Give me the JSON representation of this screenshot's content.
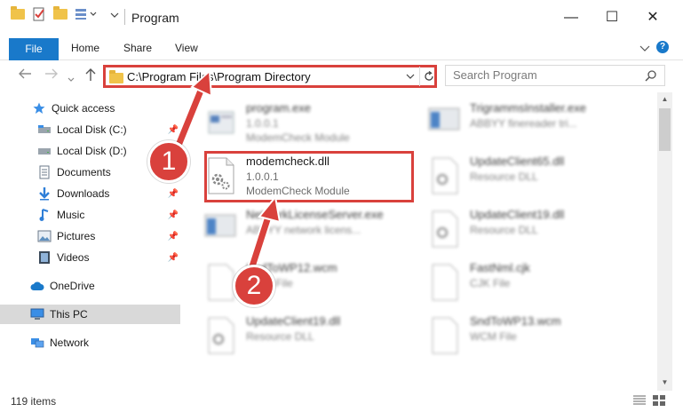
{
  "window": {
    "title": "Program",
    "minimize_glyph": "—",
    "maximize_glyph": "☐",
    "close_glyph": "✕"
  },
  "ribbon": {
    "tabs": [
      {
        "label": "File"
      },
      {
        "label": "Home"
      },
      {
        "label": "Share"
      },
      {
        "label": "View"
      }
    ]
  },
  "address": {
    "path": "C:\\Program Files\\Program Directory",
    "search_placeholder": "Search Program"
  },
  "nav_pane": {
    "items": [
      {
        "label": "Quick access",
        "icon": "star-icon"
      },
      {
        "label": "Local Disk (C:)",
        "icon": "drive-icon"
      },
      {
        "label": "Local Disk (D:)",
        "icon": "drive-icon"
      },
      {
        "label": "Documents",
        "icon": "documents-icon"
      },
      {
        "label": "Downloads",
        "icon": "download-icon"
      },
      {
        "label": "Music",
        "icon": "music-icon"
      },
      {
        "label": "Pictures",
        "icon": "pictures-icon"
      },
      {
        "label": "Videos",
        "icon": "videos-icon"
      },
      {
        "label": "OneDrive",
        "icon": "cloud-icon"
      },
      {
        "label": "This PC",
        "icon": "computer-icon"
      },
      {
        "label": "Network",
        "icon": "network-icon"
      }
    ]
  },
  "files": [
    {
      "name": "program.exe",
      "line1": "1.0.0.1",
      "line2": "ModemCheck Module"
    },
    {
      "name": "TrigrammsInstaller.exe",
      "line1": "ABBYY finereader tri...",
      "line2": ""
    },
    {
      "name": "modemcheck.dll",
      "line1": "1.0.0.1",
      "line2": "ModemCheck Module"
    },
    {
      "name": "UpdateClient65.dll",
      "line1": "Resource DLL",
      "line2": ""
    },
    {
      "name": "NetworkLicenseServer.exe",
      "line1": "ABBYY network licens...",
      "line2": ""
    },
    {
      "name": "UpdateClient19.dll",
      "line1": "Resource DLL",
      "line2": ""
    },
    {
      "name": "SndToWP12.wcm",
      "line1": "WCM File",
      "line2": ""
    },
    {
      "name": "FastNml.cjk",
      "line1": "CJK File",
      "line2": ""
    },
    {
      "name": "UpdateClient19.dll",
      "line1": "Resource DLL",
      "line2": ""
    },
    {
      "name": "SndToWP13.wcm",
      "line1": "WCM File",
      "line2": ""
    }
  ],
  "status": {
    "item_count": "119 items"
  },
  "annotations": {
    "step1": "1",
    "step2": "2"
  },
  "colors": {
    "accent": "#1979ca",
    "highlight": "#d9413c",
    "folder": "#f0c34a",
    "selected": "#d9d9d9"
  }
}
